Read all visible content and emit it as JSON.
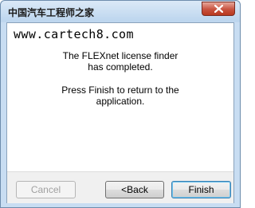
{
  "window": {
    "title": "中国汽车工程师之家",
    "close_icon": "close-icon"
  },
  "watermark": "www.cartech8.com",
  "message": {
    "line1a": "The FLEXnet license finder",
    "line1b": "has completed.",
    "line2a": "Press Finish to return to the",
    "line2b": "application."
  },
  "buttons": {
    "cancel": "Cancel",
    "back": "<Back",
    "finish": "Finish"
  },
  "colors": {
    "close_button": "#c8523f",
    "finish_focus": "#3c7fb1"
  }
}
